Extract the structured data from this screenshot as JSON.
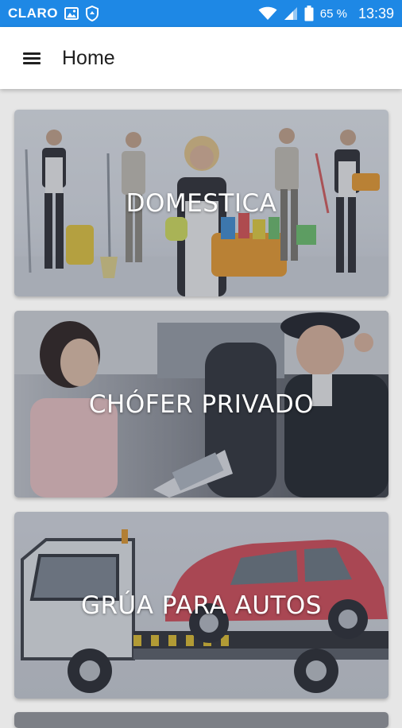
{
  "status_bar": {
    "carrier": "CLARO",
    "battery_percent": "65 %",
    "time": "13:39",
    "color": "#1e88e5"
  },
  "app_bar": {
    "title": "Home",
    "menu_icon": "hamburger-menu-icon"
  },
  "cards": [
    {
      "id": "domestica",
      "label": "DOMESTICA"
    },
    {
      "id": "chofer",
      "label": "CHÓFER PRIVADO"
    },
    {
      "id": "grua",
      "label": "GRÚA PARA AUTOS"
    }
  ]
}
